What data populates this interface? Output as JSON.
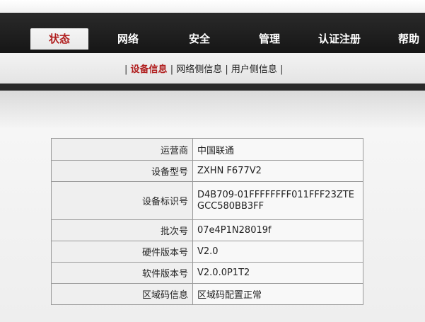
{
  "nav": {
    "tabs": [
      {
        "label": "状态",
        "active": true
      },
      {
        "label": "网络",
        "active": false
      },
      {
        "label": "安全",
        "active": false
      },
      {
        "label": "管理",
        "active": false
      },
      {
        "label": "认证注册",
        "active": false
      },
      {
        "label": "帮助",
        "active": false
      }
    ]
  },
  "subnav": {
    "separator": "|",
    "items": [
      {
        "label": "设备信息",
        "active": true
      },
      {
        "label": "网络侧信息",
        "active": false
      },
      {
        "label": "用户侧信息",
        "active": false
      }
    ]
  },
  "device_info": {
    "rows": [
      {
        "label": "运营商",
        "value": "中国联通"
      },
      {
        "label": "设备型号",
        "value": "ZXHN F677V2"
      },
      {
        "label": "设备标识号",
        "value": "D4B709-01FFFFFFFF011FFF23ZTEGCC580BB3FF"
      },
      {
        "label": "批次号",
        "value": "07e4P1N28019f"
      },
      {
        "label": "硬件版本号",
        "value": "V2.0"
      },
      {
        "label": "软件版本号",
        "value": "V2.0.0P1T2"
      },
      {
        "label": "区域码信息",
        "value": "区域码配置正常"
      }
    ]
  },
  "colors": {
    "accent": "#b01e1e",
    "navbar": "#1f1f1f"
  }
}
